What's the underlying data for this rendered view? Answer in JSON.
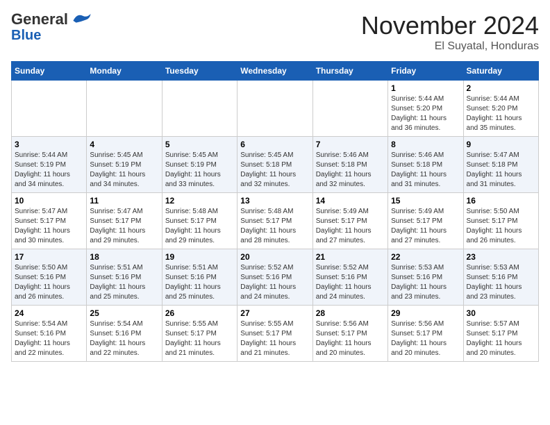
{
  "header": {
    "logo_line1": "General",
    "logo_line2": "Blue",
    "month": "November 2024",
    "location": "El Suyatal, Honduras"
  },
  "days_of_week": [
    "Sunday",
    "Monday",
    "Tuesday",
    "Wednesday",
    "Thursday",
    "Friday",
    "Saturday"
  ],
  "weeks": [
    [
      {
        "day": "",
        "info": ""
      },
      {
        "day": "",
        "info": ""
      },
      {
        "day": "",
        "info": ""
      },
      {
        "day": "",
        "info": ""
      },
      {
        "day": "",
        "info": ""
      },
      {
        "day": "1",
        "info": "Sunrise: 5:44 AM\nSunset: 5:20 PM\nDaylight: 11 hours\nand 36 minutes."
      },
      {
        "day": "2",
        "info": "Sunrise: 5:44 AM\nSunset: 5:20 PM\nDaylight: 11 hours\nand 35 minutes."
      }
    ],
    [
      {
        "day": "3",
        "info": "Sunrise: 5:44 AM\nSunset: 5:19 PM\nDaylight: 11 hours\nand 34 minutes."
      },
      {
        "day": "4",
        "info": "Sunrise: 5:45 AM\nSunset: 5:19 PM\nDaylight: 11 hours\nand 34 minutes."
      },
      {
        "day": "5",
        "info": "Sunrise: 5:45 AM\nSunset: 5:19 PM\nDaylight: 11 hours\nand 33 minutes."
      },
      {
        "day": "6",
        "info": "Sunrise: 5:45 AM\nSunset: 5:18 PM\nDaylight: 11 hours\nand 32 minutes."
      },
      {
        "day": "7",
        "info": "Sunrise: 5:46 AM\nSunset: 5:18 PM\nDaylight: 11 hours\nand 32 minutes."
      },
      {
        "day": "8",
        "info": "Sunrise: 5:46 AM\nSunset: 5:18 PM\nDaylight: 11 hours\nand 31 minutes."
      },
      {
        "day": "9",
        "info": "Sunrise: 5:47 AM\nSunset: 5:18 PM\nDaylight: 11 hours\nand 31 minutes."
      }
    ],
    [
      {
        "day": "10",
        "info": "Sunrise: 5:47 AM\nSunset: 5:17 PM\nDaylight: 11 hours\nand 30 minutes."
      },
      {
        "day": "11",
        "info": "Sunrise: 5:47 AM\nSunset: 5:17 PM\nDaylight: 11 hours\nand 29 minutes."
      },
      {
        "day": "12",
        "info": "Sunrise: 5:48 AM\nSunset: 5:17 PM\nDaylight: 11 hours\nand 29 minutes."
      },
      {
        "day": "13",
        "info": "Sunrise: 5:48 AM\nSunset: 5:17 PM\nDaylight: 11 hours\nand 28 minutes."
      },
      {
        "day": "14",
        "info": "Sunrise: 5:49 AM\nSunset: 5:17 PM\nDaylight: 11 hours\nand 27 minutes."
      },
      {
        "day": "15",
        "info": "Sunrise: 5:49 AM\nSunset: 5:17 PM\nDaylight: 11 hours\nand 27 minutes."
      },
      {
        "day": "16",
        "info": "Sunrise: 5:50 AM\nSunset: 5:17 PM\nDaylight: 11 hours\nand 26 minutes."
      }
    ],
    [
      {
        "day": "17",
        "info": "Sunrise: 5:50 AM\nSunset: 5:16 PM\nDaylight: 11 hours\nand 26 minutes."
      },
      {
        "day": "18",
        "info": "Sunrise: 5:51 AM\nSunset: 5:16 PM\nDaylight: 11 hours\nand 25 minutes."
      },
      {
        "day": "19",
        "info": "Sunrise: 5:51 AM\nSunset: 5:16 PM\nDaylight: 11 hours\nand 25 minutes."
      },
      {
        "day": "20",
        "info": "Sunrise: 5:52 AM\nSunset: 5:16 PM\nDaylight: 11 hours\nand 24 minutes."
      },
      {
        "day": "21",
        "info": "Sunrise: 5:52 AM\nSunset: 5:16 PM\nDaylight: 11 hours\nand 24 minutes."
      },
      {
        "day": "22",
        "info": "Sunrise: 5:53 AM\nSunset: 5:16 PM\nDaylight: 11 hours\nand 23 minutes."
      },
      {
        "day": "23",
        "info": "Sunrise: 5:53 AM\nSunset: 5:16 PM\nDaylight: 11 hours\nand 23 minutes."
      }
    ],
    [
      {
        "day": "24",
        "info": "Sunrise: 5:54 AM\nSunset: 5:16 PM\nDaylight: 11 hours\nand 22 minutes."
      },
      {
        "day": "25",
        "info": "Sunrise: 5:54 AM\nSunset: 5:16 PM\nDaylight: 11 hours\nand 22 minutes."
      },
      {
        "day": "26",
        "info": "Sunrise: 5:55 AM\nSunset: 5:17 PM\nDaylight: 11 hours\nand 21 minutes."
      },
      {
        "day": "27",
        "info": "Sunrise: 5:55 AM\nSunset: 5:17 PM\nDaylight: 11 hours\nand 21 minutes."
      },
      {
        "day": "28",
        "info": "Sunrise: 5:56 AM\nSunset: 5:17 PM\nDaylight: 11 hours\nand 20 minutes."
      },
      {
        "day": "29",
        "info": "Sunrise: 5:56 AM\nSunset: 5:17 PM\nDaylight: 11 hours\nand 20 minutes."
      },
      {
        "day": "30",
        "info": "Sunrise: 5:57 AM\nSunset: 5:17 PM\nDaylight: 11 hours\nand 20 minutes."
      }
    ]
  ]
}
